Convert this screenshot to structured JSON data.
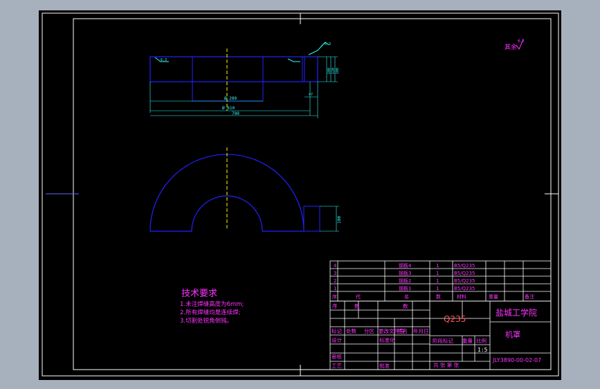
{
  "drawing": {
    "roughness_note": "其余",
    "dimensions": {
      "inner_diameter": "Ø 280",
      "outer_diameter": "Ø 610",
      "overall_length": "700",
      "flange_offset": "47",
      "thickness": "100",
      "height_a": "100",
      "height_b": "120",
      "plan_width": "100"
    },
    "roughness_value_left": "6.3",
    "roughness_value_right": "6.3"
  },
  "technical_requirements": {
    "title": "技术要求",
    "items": [
      "1.未注焊缝高度为6mm;",
      "2.所有焊缝均是连续焊;",
      "3.切割处锐角倒钝。"
    ]
  },
  "bom": {
    "rows": [
      {
        "no": "4",
        "name": "钢板4",
        "qty": "1",
        "material": "B5/Q235"
      },
      {
        "no": "3",
        "name": "钢板3",
        "qty": "1",
        "material": "B5/Q235"
      },
      {
        "no": "2",
        "name": "钢板2",
        "qty": "1",
        "material": "B5/Q235"
      },
      {
        "no": "1",
        "name": "钢板1",
        "qty": "1",
        "material": "B5/Q235"
      }
    ],
    "header": {
      "no": "序",
      "code": "代",
      "name": "名",
      "qty": "数",
      "material": "材料",
      "weight": "重量",
      "remark": "备注"
    }
  },
  "title_block": {
    "material": "Q235",
    "school": "盐城工学院",
    "part_name": "机罩",
    "drawing_no": "JLY3890-00-02-07",
    "scale": "1:5",
    "labels": {
      "mark": "标记",
      "count": "处数",
      "zone": "分区",
      "change_doc": "更改文件号",
      "sign": "签名",
      "date": "年月日",
      "design": "设计",
      "standardize": "标准化",
      "review": "审核",
      "process": "工艺",
      "approve": "批准",
      "stage_mark": "阶段标记",
      "weight": "重量",
      "ratio": "比例",
      "sheets": "共  张 第  张",
      "serial": "序",
      "count_col": "数"
    }
  },
  "colors": {
    "frame": "#ffffff",
    "outline": "#2222ff",
    "dimension": "#33ffff",
    "centerline": "#ffff00",
    "text": "#ff33ff",
    "background": "#000000"
  }
}
